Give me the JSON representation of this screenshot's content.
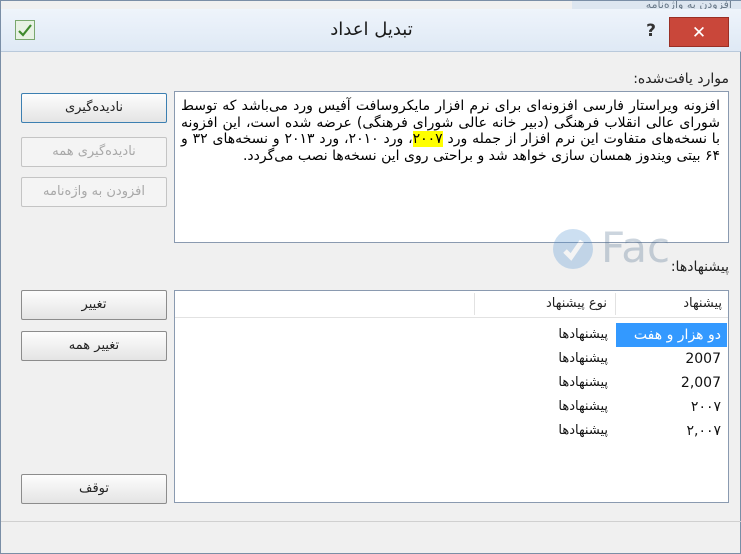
{
  "background_window_text": "افزودن به واژه‌نامه",
  "window": {
    "title": "تبدیل اعداد",
    "help_label": "?",
    "close_label": "✕"
  },
  "found_label": "موارد یافت‌شده:",
  "found_text": {
    "before": "افزونه ویراستار فارسی افزونه‌ای برای نرم افزار مایکروسافت آفیس ورد می‌باشد که توسط شورای عالی انقلاب فرهنگی (دبیر خانه عالی شورای فرهنگی) عرضه شده است، این افزونه با نسخه‌های متفاوت این نرم افزار از جمله ورد ",
    "highlight": "۲۰۰۷",
    "after": "، ورد ۲۰۱۰، ورد ۲۰۱۳ و نسخه‌های ۳۲ و ۶۴ بیتی ویندوز همسان سازی خواهد شد و براحتی روی این نسخه‌ها نصب می‌گردد."
  },
  "buttons": {
    "ignore": "نادیده‌گیری",
    "ignore_all": "نادیده‌گیری همه",
    "add_to_dictionary": "افزودن به واژه‌نامه",
    "change": "تغییر",
    "change_all": "تغییر همه",
    "stop": "توقف"
  },
  "suggestions_label": "پیشنهادها:",
  "suggestions": {
    "columns": [
      "پیشنهاد",
      "نوع پیشنهاد"
    ],
    "rows": [
      {
        "word": "دو هزار و هفت",
        "type": "پیشنهادها",
        "selected": true
      },
      {
        "word": "2007",
        "type": "پیشنهادها",
        "selected": false
      },
      {
        "word": "2,007",
        "type": "پیشنهادها",
        "selected": false
      },
      {
        "word": "۲۰۰۷",
        "type": "پیشنهادها",
        "selected": false
      },
      {
        "word": "۲,۰۰۷",
        "type": "پیشنهادها",
        "selected": false
      }
    ]
  },
  "colors": {
    "selection": "#3399ff",
    "close_button": "#c9473a",
    "highlight": "#ffff00"
  }
}
